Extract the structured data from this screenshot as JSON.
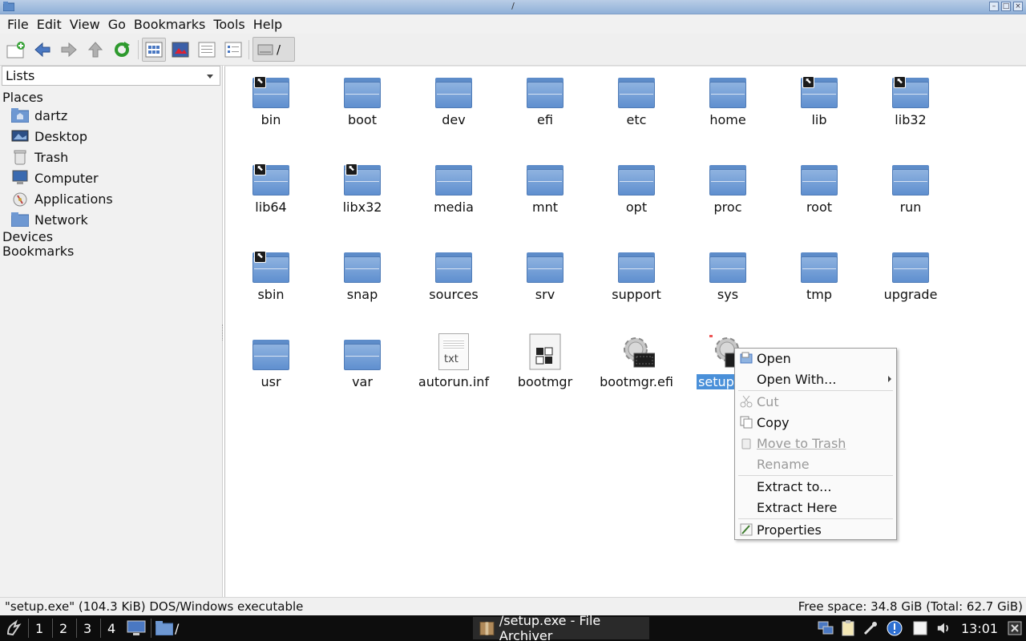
{
  "window": {
    "title": "/"
  },
  "menubar": {
    "items": [
      "File",
      "Edit",
      "View",
      "Go",
      "Bookmarks",
      "Tools",
      "Help"
    ]
  },
  "toolbar": {
    "path_label": "/"
  },
  "sidebar": {
    "list_mode": "Lists",
    "places_label": "Places",
    "places": [
      {
        "label": "dartz",
        "icon": "home-folder-icon"
      },
      {
        "label": "Desktop",
        "icon": "desktop-icon"
      },
      {
        "label": "Trash",
        "icon": "trash-icon"
      },
      {
        "label": "Computer",
        "icon": "computer-icon"
      },
      {
        "label": "Applications",
        "icon": "applications-icon"
      },
      {
        "label": "Network",
        "icon": "network-icon"
      }
    ],
    "devices_label": "Devices",
    "bookmarks_label": "Bookmarks"
  },
  "files": [
    {
      "name": "bin",
      "kind": "folder-link"
    },
    {
      "name": "boot",
      "kind": "folder"
    },
    {
      "name": "dev",
      "kind": "folder"
    },
    {
      "name": "efi",
      "kind": "folder"
    },
    {
      "name": "etc",
      "kind": "folder"
    },
    {
      "name": "home",
      "kind": "folder"
    },
    {
      "name": "lib",
      "kind": "folder-link"
    },
    {
      "name": "lib32",
      "kind": "folder-link"
    },
    {
      "name": "lib64",
      "kind": "folder-link"
    },
    {
      "name": "libx32",
      "kind": "folder-link"
    },
    {
      "name": "media",
      "kind": "folder"
    },
    {
      "name": "mnt",
      "kind": "folder"
    },
    {
      "name": "opt",
      "kind": "folder"
    },
    {
      "name": "proc",
      "kind": "folder"
    },
    {
      "name": "root",
      "kind": "folder"
    },
    {
      "name": "run",
      "kind": "folder"
    },
    {
      "name": "sbin",
      "kind": "folder-link"
    },
    {
      "name": "snap",
      "kind": "folder"
    },
    {
      "name": "sources",
      "kind": "folder"
    },
    {
      "name": "srv",
      "kind": "folder"
    },
    {
      "name": "support",
      "kind": "folder"
    },
    {
      "name": "sys",
      "kind": "folder"
    },
    {
      "name": "tmp",
      "kind": "folder"
    },
    {
      "name": "upgrade",
      "kind": "folder"
    },
    {
      "name": "usr",
      "kind": "folder"
    },
    {
      "name": "var",
      "kind": "folder"
    },
    {
      "name": "autorun.inf",
      "kind": "text",
      "icon_text": "txt"
    },
    {
      "name": "bootmgr",
      "kind": "binary"
    },
    {
      "name": "bootmgr.efi",
      "kind": "executable"
    },
    {
      "name": "setup.",
      "kind": "executable",
      "selected": true
    }
  ],
  "context_menu": {
    "items": [
      {
        "label": "Open",
        "enabled": true,
        "icon": "open-icon"
      },
      {
        "label": "Open With...",
        "enabled": true,
        "submenu": true
      },
      {
        "label": "Cut",
        "enabled": false,
        "icon": "cut-icon"
      },
      {
        "label": "Copy",
        "enabled": true,
        "icon": "copy-icon"
      },
      {
        "label": "Move to Trash",
        "enabled": false,
        "icon": "trash-icon"
      },
      {
        "label": "Rename",
        "enabled": false
      },
      {
        "label": "Extract to...",
        "enabled": true
      },
      {
        "label": "Extract Here",
        "enabled": true
      },
      {
        "label": "Properties",
        "enabled": true,
        "icon": "properties-icon"
      }
    ]
  },
  "statusbar": {
    "left": "\"setup.exe\" (104.3 KiB) DOS/Windows executable",
    "right": "Free space: 34.8 GiB (Total: 62.7 GiB)"
  },
  "taskbar": {
    "desktops": [
      "1",
      "2",
      "3",
      "4"
    ],
    "folder_label": "/",
    "task_title": "/setup.exe - File Archiver",
    "clock": "13:01"
  }
}
